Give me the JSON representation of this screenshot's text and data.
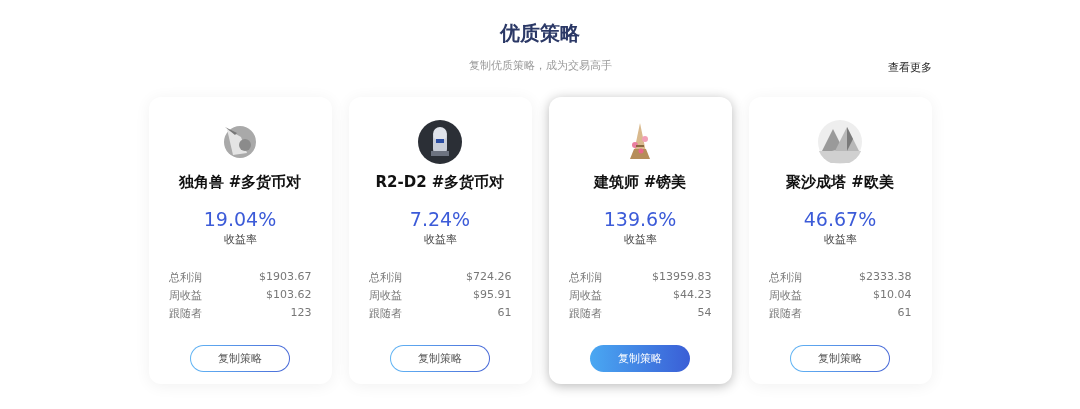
{
  "section": {
    "title": "优质策略",
    "subtitle": "复制优质策略，成为交易高手",
    "more_link": "查看更多"
  },
  "cards": [
    {
      "avatar": {
        "kind": "picture"
      },
      "name": "独角兽 #多货币对",
      "rate": "19.04%",
      "rate_label": "收益率",
      "stats": [
        {
          "label": "总利润",
          "value": "$1903.67"
        },
        {
          "label": "周收益",
          "value": "$103.62"
        },
        {
          "label": "跟随者",
          "value": "123"
        }
      ],
      "button": "复制策略",
      "selected": false
    },
    {
      "avatar": {
        "kind": "picture"
      },
      "name": "R2-D2 #多货币对",
      "rate": "7.24%",
      "rate_label": "收益率",
      "stats": [
        {
          "label": "总利润",
          "value": "$724.26"
        },
        {
          "label": "周收益",
          "value": "$95.91"
        },
        {
          "label": "跟随者",
          "value": "61"
        }
      ],
      "button": "复制策略",
      "selected": false
    },
    {
      "avatar": {
        "kind": "picture"
      },
      "name": "建筑师 #镑美",
      "rate": "139.6%",
      "rate_label": "收益率",
      "stats": [
        {
          "label": "总利润",
          "value": "$13959.83"
        },
        {
          "label": "周收益",
          "value": "$44.23"
        },
        {
          "label": "跟随者",
          "value": "54"
        }
      ],
      "button": "复制策略",
      "selected": true
    },
    {
      "avatar": {
        "kind": "picture"
      },
      "name": "聚沙成塔 #欧美",
      "rate": "46.67%",
      "rate_label": "收益率",
      "stats": [
        {
          "label": "总利润",
          "value": "$2333.38"
        },
        {
          "label": "周收益",
          "value": "$10.04"
        },
        {
          "label": "跟随者",
          "value": "61"
        }
      ],
      "button": "复制策略",
      "selected": false
    }
  ]
}
